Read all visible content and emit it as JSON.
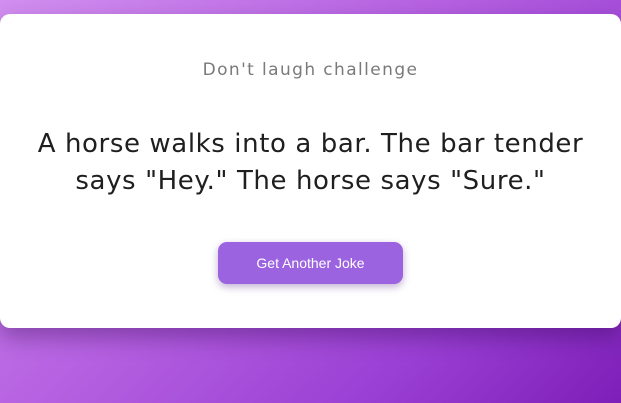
{
  "header": {
    "title": "Don't laugh challenge"
  },
  "joke": {
    "text": "A horse walks into a bar. The bar tender says \"Hey.\" The horse says \"Sure.\""
  },
  "actions": {
    "get_joke_label": "Get Another Joke"
  },
  "colors": {
    "accent": "#9b63e0",
    "card_background": "#ffffff",
    "background_gradient": [
      "#d28ff0",
      "#b45fe0",
      "#9a3fd4",
      "#7d1fb8"
    ]
  }
}
